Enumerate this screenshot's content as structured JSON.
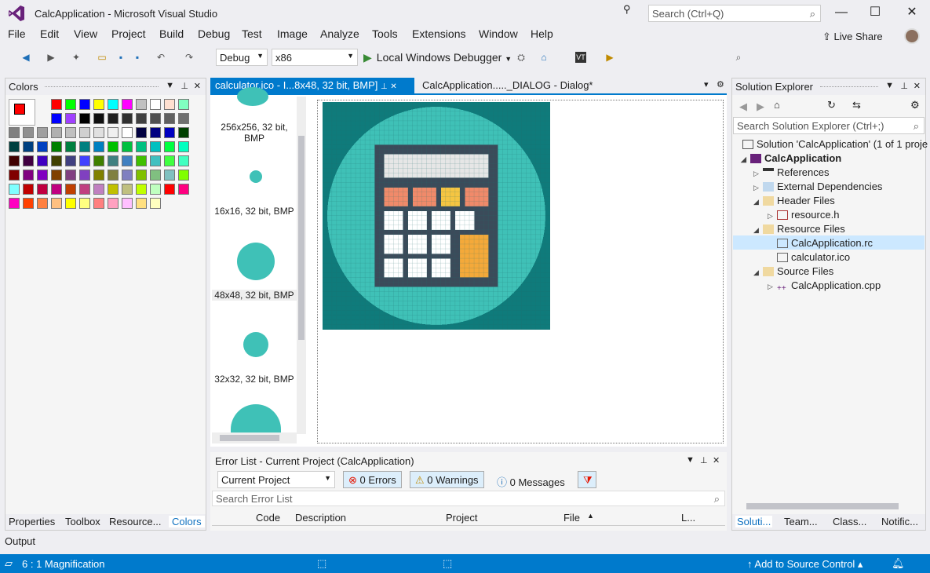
{
  "window": {
    "title": "CalcApplication - Microsoft Visual Studio",
    "search_placeholder": "Search (Ctrl+Q)"
  },
  "menu": [
    "File",
    "Edit",
    "View",
    "Project",
    "Build",
    "Debug",
    "Test",
    "Image",
    "Analyze",
    "Tools",
    "Extensions",
    "Window",
    "Help"
  ],
  "live_share": "Live Share",
  "toolbar": {
    "config": "Debug",
    "platform": "x86",
    "debugger": "Local Windows Debugger"
  },
  "colors_panel": {
    "title": "Colors",
    "tabs": [
      "Properties",
      "Toolbox",
      "Resource...",
      "Colors"
    ]
  },
  "doc_tabs": {
    "active": "calculator.ico - I...8x48, 32 bit, BMP]",
    "second": "CalcApplication....._DIALOG - Dialog*"
  },
  "thumbnails": [
    "256x256, 32 bit, BMP",
    "16x16, 32 bit, BMP",
    "48x48, 32 bit, BMP",
    "32x32, 32 bit, BMP"
  ],
  "error_list": {
    "title": "Error List - Current Project (CalcApplication)",
    "scope": "Current Project",
    "errors": "0 Errors",
    "warnings": "0 Warnings",
    "messages": "0 Messages",
    "search_placeholder": "Search Error List",
    "columns": [
      "Code",
      "Description",
      "Project",
      "File",
      "L..."
    ]
  },
  "solution_explorer": {
    "title": "Solution Explorer",
    "search_placeholder": "Search Solution Explorer (Ctrl+;)",
    "items": [
      "Solution 'CalcApplication' (1 of 1 proje",
      "CalcApplication",
      "References",
      "External Dependencies",
      "Header Files",
      "resource.h",
      "Resource Files",
      "CalcApplication.rc",
      "calculator.ico",
      "Source Files",
      "CalcApplication.cpp"
    ],
    "tabs": [
      "Soluti...",
      "Team...",
      "Class...",
      "Notific..."
    ]
  },
  "output_tab": "Output",
  "status": {
    "magnification": "6 : 1 Magnification",
    "source_control": "Add to Source Control"
  },
  "accent": "#007acc",
  "palette_colors": [
    "#ff0000",
    "#00ff00",
    "#0000ff",
    "#ffff00",
    "#00ffff",
    "#ff00ff",
    "#c0c0c0",
    "#ffffff",
    "#ffe0d0",
    "#80ffc0",
    "#0000ff",
    "#a040ff",
    "#000000",
    "#101010",
    "#202020",
    "#303030",
    "#404040",
    "#505050",
    "#606060",
    "#707070",
    "#808080",
    "#909090",
    "#a0a0a0",
    "#b0b0b0",
    "#c0c0c0",
    "#d0d0d0",
    "#e0e0e0",
    "#f0f0f0",
    "#ffffff",
    "#000040",
    "#000080",
    "#0000c0",
    "#004000",
    "#004040",
    "#004080",
    "#0040c0",
    "#008000",
    "#008040",
    "#008080",
    "#0080c0",
    "#00c000",
    "#00c040",
    "#00c080",
    "#00c0c0",
    "#00ff40",
    "#00ffc0",
    "#400000",
    "#400040",
    "#4000c0",
    "#404000",
    "#404080",
    "#4040ff",
    "#408000",
    "#408080",
    "#4080c0",
    "#40c000",
    "#40c0c0",
    "#40ff40",
    "#40ffc0",
    "#800000",
    "#800080",
    "#8000c0",
    "#804000",
    "#804080",
    "#8040c0",
    "#808000",
    "#808040",
    "#8080c0",
    "#80c000",
    "#80c080",
    "#80c0c0",
    "#80ff00",
    "#80ffff",
    "#c00000",
    "#c00040",
    "#c00080",
    "#c04000",
    "#c04080",
    "#c080c0",
    "#c0c000",
    "#c0c080",
    "#c0ff00",
    "#c0ffc0",
    "#ff0000",
    "#ff0080",
    "#ff00c0",
    "#ff4000",
    "#ff8040",
    "#ffc080",
    "#ffff00",
    "#ffff80",
    "#ff8080",
    "#ffa0c0",
    "#ffc0ff",
    "#ffe080",
    "#ffffc0"
  ]
}
